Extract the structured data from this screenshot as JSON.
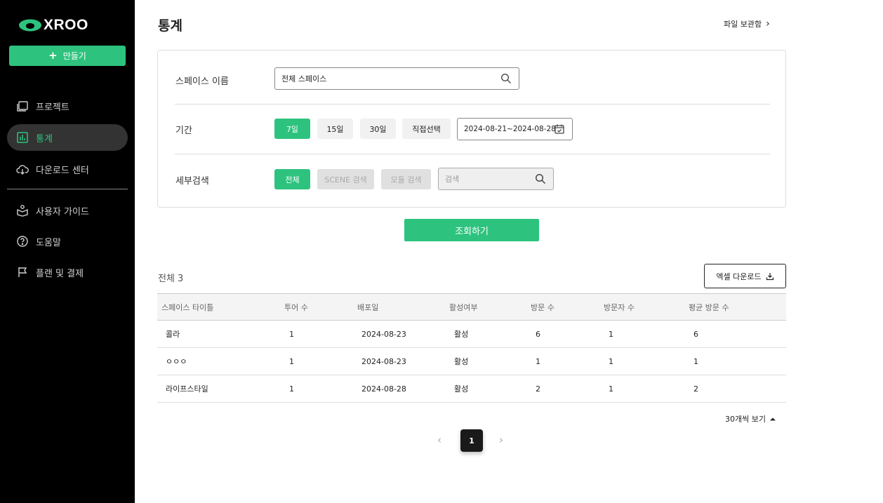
{
  "brand": {
    "logo_text": "XROO",
    "accent": "#2dc37e"
  },
  "sidebar": {
    "create_label": "만들기",
    "items": [
      {
        "label": "프로젝트",
        "icon": "folder-icon"
      },
      {
        "label": "통계",
        "icon": "chart-icon",
        "active": true
      },
      {
        "label": "다운로드 센터",
        "icon": "cloud-download-icon"
      },
      {
        "label": "사용자 가이드",
        "icon": "guide-icon"
      },
      {
        "label": "도움말",
        "icon": "help-icon"
      },
      {
        "label": "플랜 및 결제",
        "icon": "flag-icon"
      }
    ]
  },
  "header": {
    "title": "통계",
    "file_link": "파일 보관함"
  },
  "filters": {
    "space_name_label": "스페이스 이름",
    "space_name_value": "전체 스페이스",
    "period_label": "기간",
    "period_options": [
      "7일",
      "15일",
      "30일",
      "직접선택"
    ],
    "period_selected": "7일",
    "date_range": "2024-08-21~2024-08-28",
    "detail_label": "세부검색",
    "detail_options": [
      "전체",
      "SCENE 검색",
      "모듈 검색"
    ],
    "detail_placeholder": "검색"
  },
  "query_label": "조회하기",
  "results": {
    "total_label": "전체 3",
    "excel_label": "엑셀 다운로드",
    "columns": [
      "스페이스 타이틀",
      "투어 수",
      "배포일",
      "활성여부",
      "방문 수",
      "방문자 수",
      "평균 방문 수"
    ],
    "rows": [
      [
        "콜라",
        "1",
        "2024-08-23",
        "활성",
        "6",
        "1",
        "6"
      ],
      [
        "ㅇㅇㅇ",
        "1",
        "2024-08-23",
        "활성",
        "1",
        "1",
        "1"
      ],
      [
        "라이프스타일",
        "1",
        "2024-08-28",
        "활성",
        "2",
        "1",
        "2"
      ]
    ]
  },
  "pagination": {
    "per_page_label": "30개씩 보기",
    "current_page": "1"
  }
}
